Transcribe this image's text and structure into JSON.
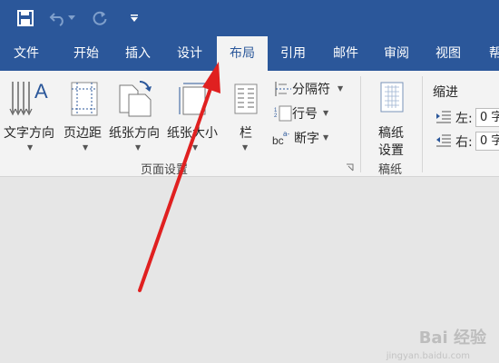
{
  "tabs": [
    "文件",
    "开始",
    "插入",
    "设计",
    "布局",
    "引用",
    "邮件",
    "审阅",
    "视图",
    "帮"
  ],
  "active_tab": "布局",
  "ribbon": {
    "text_direction": "文字方向",
    "margins": "页边距",
    "orientation": "纸张方向",
    "size": "纸张大小",
    "columns": "栏",
    "breaks": "分隔符",
    "line_numbers": "行号",
    "hyphenation": "断字",
    "page_setup_group": "页面设置",
    "draft_settings_line1": "稿纸",
    "draft_settings_line2": "设置",
    "draft_group": "稿纸",
    "indent_title": "缩进",
    "indent_left_label": "左:",
    "indent_left_value": "0 字",
    "indent_right_label": "右:",
    "indent_right_value": "0 字"
  },
  "watermark": {
    "main": "Bai 经验",
    "sub": "jingyan.baidu.com"
  },
  "colors": {
    "brand": "#2b579a",
    "arrow": "#e02020",
    "ribbon": "#f3f3f3"
  }
}
